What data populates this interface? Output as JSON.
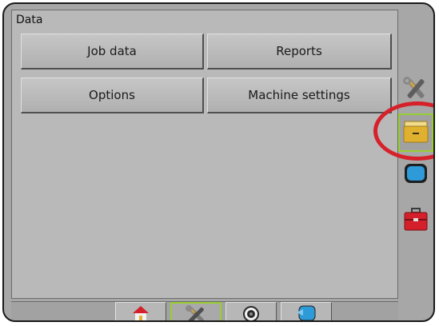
{
  "panel": {
    "title": "Data",
    "buttons": {
      "job_data": "Job data",
      "reports": "Reports",
      "options": "Options",
      "machine_settings": "Machine settings"
    }
  },
  "side_tabs": [
    {
      "icon": "wrench-screwdriver-icon",
      "active": false
    },
    {
      "icon": "data-folder-icon",
      "active": true,
      "highlighted": true
    },
    {
      "icon": "screen-icon",
      "active": false
    },
    {
      "icon": "toolbox-icon",
      "active": false
    }
  ],
  "bottom_tabs": [
    {
      "icon": "home-icon",
      "active": false
    },
    {
      "icon": "wrench-screwdriver-icon",
      "active": true
    },
    {
      "icon": "camera-lens-icon",
      "active": false
    },
    {
      "icon": "guidance-icon",
      "active": false
    }
  ],
  "colors": {
    "active_outline": "#9acd32",
    "highlight_ring": "#d6202a"
  }
}
